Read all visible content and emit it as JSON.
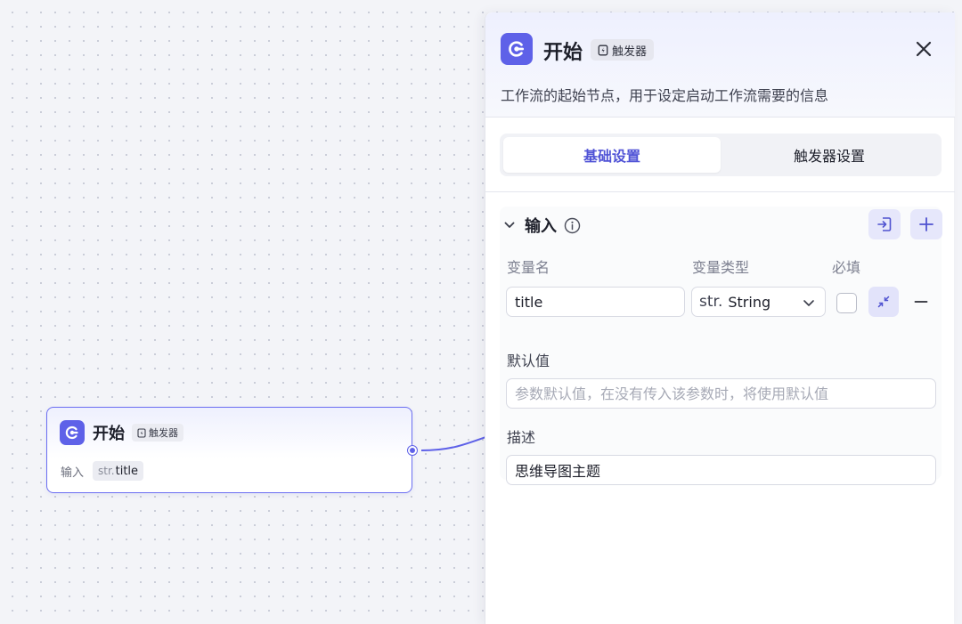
{
  "node": {
    "title": "开始",
    "badge": "触发器",
    "input_label": "输入",
    "tag_type": "str.",
    "tag_var": "title"
  },
  "panel": {
    "title": "开始",
    "badge": "触发器",
    "description": "工作流的起始节点，用于设定启动工作流需要的信息",
    "tabs": [
      {
        "label": "基础设置",
        "active": true
      },
      {
        "label": "触发器设置",
        "active": false
      }
    ],
    "section": {
      "title": "输入",
      "columns": {
        "name": "变量名",
        "type": "变量类型",
        "required": "必填"
      },
      "variable": {
        "name": "title",
        "type_prefix": "str.",
        "type": "String",
        "required": false
      },
      "default_label": "默认值",
      "default_placeholder": "参数默认值，在没有传入该参数时，将使用默认值",
      "desc_label": "描述",
      "desc_value": "思维导图主题"
    }
  },
  "colors": {
    "accent": "#5e61e8",
    "accent_text": "#5053d6",
    "canvas": "#f3f4f8"
  }
}
